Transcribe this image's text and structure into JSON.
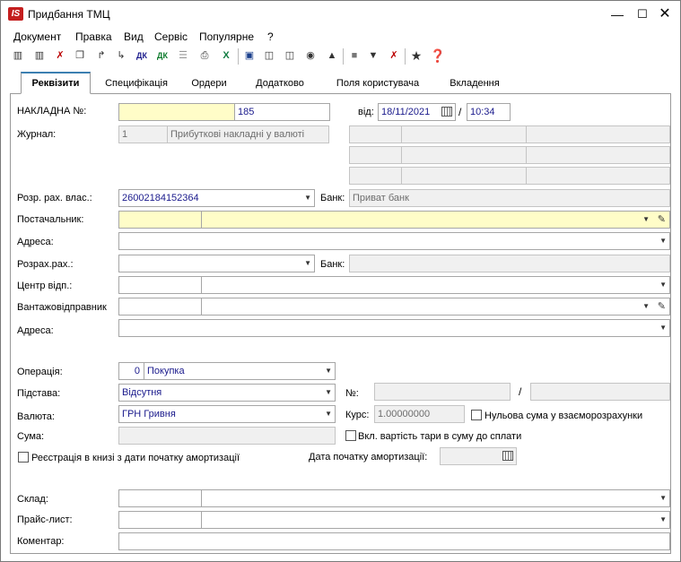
{
  "window": {
    "title": "Придбання ТМЦ",
    "logo": "IS"
  },
  "menu": [
    "Документ",
    "Правка",
    "Вид",
    "Сервіс",
    "Популярне",
    "?"
  ],
  "tabs": [
    "Реквізити",
    "Специфікація",
    "Ордери",
    "Додатково",
    "Поля користувача",
    "Вкладення"
  ],
  "form": {
    "invoice_label": "НАКЛАДНА №:",
    "invoice_number": "185",
    "from_label": "від:",
    "date": "18/11/2021",
    "slash": "/",
    "time": "10:34",
    "journal_label": "Журнал:",
    "journal_code": "1",
    "journal_name": "Прибуткові накладні у валюті",
    "own_account_label": "Розр. рах. влас.:",
    "own_account": "26002184152364",
    "bank_label": "Банк:",
    "own_bank": "Приват банк",
    "supplier_label": "Постачальник:",
    "address_label": "Адреса:",
    "account_label": "Розрах.рах.:",
    "bank_label2": "Банк:",
    "center_label": "Центр відп.:",
    "shipper_label": "Вантажовідправник",
    "address2_label": "Адреса:",
    "operation_label": "Операція:",
    "operation_code": "0",
    "operation": "Покупка",
    "basis_label": "Підстава:",
    "basis": "Відсутня",
    "number_label": "№:",
    "slash2": "/",
    "currency_label": "Валюта:",
    "currency": "ГРН Гривня",
    "rate_label": "Курс:",
    "rate": "1.00000000",
    "zero_sum_label": "Нульова сума у взаєморозрахунки",
    "sum_label": "Сума:",
    "tare_label": "Вкл. вартість тари в суму до сплати",
    "registration_label": "Реєстрація в книзі з дати початку амортизації",
    "depr_date_label": "Дата початку амортизації:",
    "warehouse_label": "Склад:",
    "price_list_label": "Прайс-лист:",
    "comment_label": "Коментар:"
  }
}
